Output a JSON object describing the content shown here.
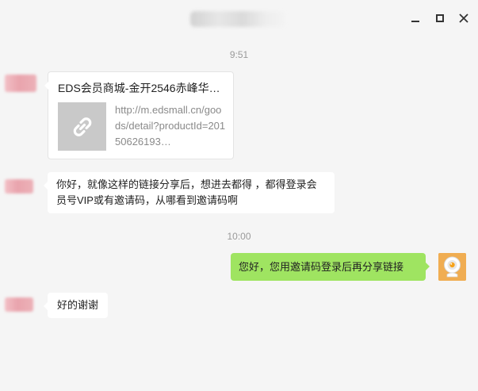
{
  "window": {
    "controls": {
      "minimize_icon": "minimize-icon",
      "maximize_icon": "maximize-icon",
      "close_icon": "close-icon"
    }
  },
  "chat": {
    "timestamps": [
      "9:51",
      "10:00"
    ],
    "messages": [
      {
        "sender": "other",
        "type": "link",
        "title": "EDS会员商城-金开2546赤峰华…",
        "url": "http://m.edsmall.cn/goods/detail?productId=20150626193…",
        "thumbnail_icon": "link-icon"
      },
      {
        "sender": "other",
        "type": "text",
        "text": "你好，就像这样的链接分享后，想进去都得 ，都得登录会员号VIP或有邀请码，从哪看到邀请码啊"
      },
      {
        "sender": "me",
        "type": "text",
        "text": "您好，您用邀请码登录后再分享链接"
      },
      {
        "sender": "other",
        "type": "text",
        "text": "好的谢谢"
      }
    ]
  },
  "colors": {
    "background": "#f5f5f5",
    "incoming_bubble": "#ffffff",
    "outgoing_bubble": "#9fe461",
    "timestamp": "#9a9a9a",
    "link_thumbnail": "#c9c9c9"
  }
}
